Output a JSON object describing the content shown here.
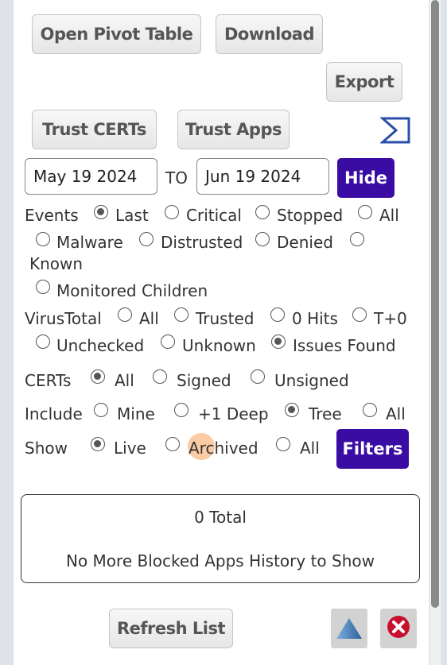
{
  "toolbar": {
    "pivot": "Open Pivot Table",
    "download": "Download",
    "export": "Export",
    "trust_certs": "Trust CERTs",
    "trust_apps": "Trust Apps",
    "sum_icon": "sigma-icon"
  },
  "dates": {
    "from": "May 19 2024",
    "to_label": "TO",
    "to": "Jun 19 2024",
    "hide": "Hide"
  },
  "events": {
    "label": "Events",
    "options": [
      "Last",
      "Critical",
      "Stopped",
      "All",
      "Malware",
      "Distrusted",
      "Denied",
      "Known",
      "Monitored Children"
    ],
    "selected": "Last"
  },
  "virustotal": {
    "label": "VirusTotal",
    "options": [
      "All",
      "Trusted",
      "0 Hits",
      "T+0",
      "Unchecked",
      "Unknown",
      "Issues Found"
    ],
    "selected": "Issues Found"
  },
  "certs": {
    "label": "CERTs",
    "options": [
      "All",
      "Signed",
      "Unsigned"
    ],
    "selected": "All"
  },
  "include": {
    "label": "Include",
    "options": [
      "Mine",
      "+1 Deep",
      "Tree",
      "All"
    ],
    "selected": "Tree"
  },
  "show": {
    "label": "Show",
    "options": [
      "Live",
      "Archived",
      "All"
    ],
    "selected": "Live",
    "filters": "Filters"
  },
  "results": {
    "total": "0 Total",
    "message": "No More Blocked Apps History to Show"
  },
  "footer": {
    "refresh": "Refresh List",
    "up_icon": "triangle-up-icon",
    "close_icon": "close-icon"
  },
  "colors": {
    "accent": "#3a0ca3",
    "close": "#c8102e"
  }
}
